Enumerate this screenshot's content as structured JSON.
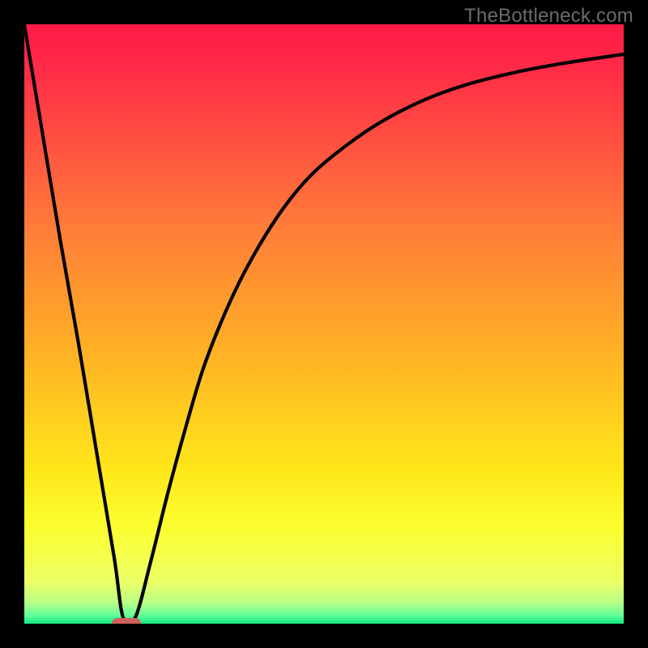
{
  "watermark": "TheBottleneck.com",
  "colors": {
    "frame": "#000000",
    "curve": "#000000",
    "marker": "#cd5f5c",
    "gradient_stops": [
      {
        "offset": 0.0,
        "color": "#ff1a47"
      },
      {
        "offset": 0.07,
        "color": "#ff2a47"
      },
      {
        "offset": 0.33,
        "color": "#ff7a3a"
      },
      {
        "offset": 0.55,
        "color": "#ffb225"
      },
      {
        "offset": 0.74,
        "color": "#ffe61a"
      },
      {
        "offset": 0.84,
        "color": "#fbff30"
      },
      {
        "offset": 0.93,
        "color": "#ecff66"
      },
      {
        "offset": 0.965,
        "color": "#b8ff86"
      },
      {
        "offset": 0.985,
        "color": "#66ff99"
      },
      {
        "offset": 1.0,
        "color": "#12e884"
      }
    ]
  },
  "chart_data": {
    "type": "line",
    "title": "",
    "xlabel": "",
    "ylabel": "",
    "xlim": [
      0,
      100
    ],
    "ylim": [
      0,
      100
    ],
    "annotations": [
      {
        "kind": "marker",
        "x": 17,
        "y": 0,
        "shape": "rounded-bar"
      }
    ],
    "series": [
      {
        "name": "curve",
        "x": [
          0,
          3,
          6,
          9,
          12,
          15,
          16.5,
          18.5,
          21,
          24,
          27,
          30,
          34,
          38,
          43,
          48,
          54,
          60,
          67,
          74,
          82,
          90,
          100
        ],
        "y": [
          100,
          82,
          64,
          47,
          29,
          11,
          1,
          1,
          10,
          22,
          33,
          43,
          53,
          61,
          69,
          75,
          80,
          84,
          87.5,
          90,
          92,
          93.5,
          95
        ]
      }
    ]
  }
}
